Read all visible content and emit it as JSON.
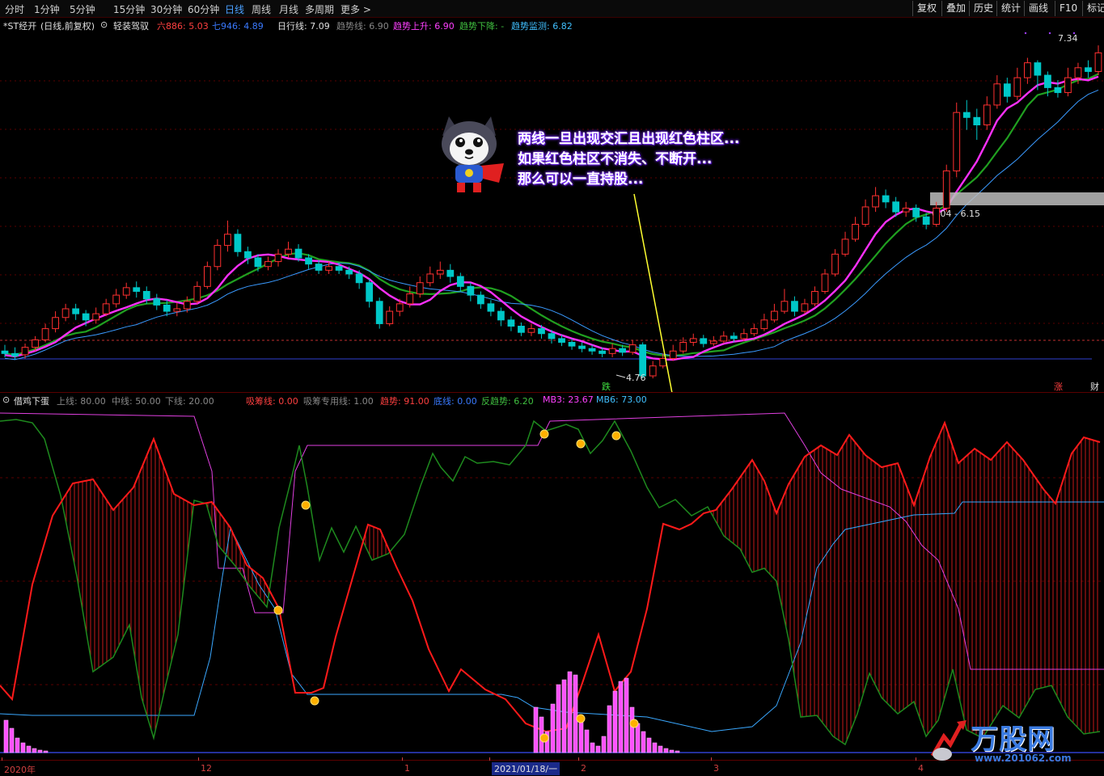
{
  "toolbar": {
    "periods": [
      "分时",
      "1分钟",
      "5分钟",
      "15分钟",
      "30分钟",
      "60分钟",
      "日线",
      "周线",
      "月线",
      "多周期",
      "更多 >"
    ],
    "active_period": "日线",
    "right_buttons": [
      "复权",
      "叠加",
      "历史",
      "统计",
      "画线",
      "F10",
      "标记"
    ]
  },
  "main_panel": {
    "stock": "*ST经开",
    "mode": "(日线,前复权)",
    "indicator_name": "轻装驾驭",
    "legend": [
      {
        "label": "六886: 5.03",
        "color": "#ff4040"
      },
      {
        "label": "七946: 4.89",
        "color": "#3a7aff"
      },
      {
        "label": "日行线: 7.09",
        "color": "#e0e0e0"
      },
      {
        "label": "趋势线: 6.90",
        "color": "#888888"
      },
      {
        "label": "趋势上升: 6.90",
        "color": "#ff40ff"
      },
      {
        "label": "趋势下降: -",
        "color": "#40c040"
      },
      {
        "label": "趋势监测: 6.82",
        "color": "#40c0ff"
      }
    ],
    "price_high_label": "7.34",
    "price_low_label": "4.76",
    "range_box_label": "6.04 - 6.15",
    "tags": {
      "fall": "跌",
      "rise": "涨",
      "fin": "财"
    }
  },
  "annotation": {
    "lines": [
      "两线一旦出现交汇且出现红色柱区...",
      "如果红色柱区不消失、不断开...",
      "那么可以一直持股..."
    ]
  },
  "sub_panel": {
    "indicator_name": "借鸡下蛋",
    "legend": [
      {
        "label": "上线: 80.00",
        "color": "#888888"
      },
      {
        "label": "中线: 50.00",
        "color": "#888888"
      },
      {
        "label": "下线: 20.00",
        "color": "#888888"
      },
      {
        "label": "吸筹线: 0.00",
        "color": "#ff4040"
      },
      {
        "label": "吸筹专用线: 1.00",
        "color": "#888888"
      },
      {
        "label": "趋势: 91.00",
        "color": "#ff4040"
      },
      {
        "label": "底线: 0.00",
        "color": "#3a7aff"
      },
      {
        "label": "反趋势: 6.20",
        "color": "#40c040"
      },
      {
        "label": "MB3: 23.67",
        "color": "#ff40ff"
      },
      {
        "label": "MB6: 73.00",
        "color": "#40c0ff"
      }
    ]
  },
  "date_axis": {
    "labels": [
      "2020年",
      "12",
      "1",
      "2021/01/18/一",
      "2",
      "3",
      "4"
    ],
    "selected": "2021/01/18/一"
  },
  "watermark": {
    "brand": "万股网",
    "url": "www.201062.com"
  },
  "colors": {
    "up": "#ff3030",
    "down": "#00c8c8",
    "ma_magenta": "#ff30ff",
    "ma_blue": "#3a9aff",
    "ma_green": "#20a020",
    "trend_red": "#ff1a1a",
    "counter_green": "#1e8a1e",
    "mb3": "#e040e0",
    "mb6": "#3aa8ff"
  },
  "chart_data": {
    "type": "candlestick",
    "price_range": [
      4.76,
      7.34
    ],
    "candles": [
      [
        4.9,
        4.88,
        4.95,
        4.85
      ],
      [
        4.88,
        4.86,
        4.93,
        4.83
      ],
      [
        4.87,
        4.93,
        4.96,
        4.84
      ],
      [
        4.93,
        4.99,
        5.02,
        4.9
      ],
      [
        4.99,
        5.08,
        5.12,
        4.97
      ],
      [
        5.08,
        5.17,
        5.22,
        5.05
      ],
      [
        5.17,
        5.24,
        5.28,
        5.14
      ],
      [
        5.24,
        5.2,
        5.28,
        5.15
      ],
      [
        5.2,
        5.15,
        5.23,
        5.1
      ],
      [
        5.15,
        5.2,
        5.25,
        5.12
      ],
      [
        5.2,
        5.28,
        5.32,
        5.18
      ],
      [
        5.28,
        5.35,
        5.4,
        5.25
      ],
      [
        5.35,
        5.41,
        5.45,
        5.32
      ],
      [
        5.41,
        5.38,
        5.46,
        5.33
      ],
      [
        5.38,
        5.32,
        5.42,
        5.28
      ],
      [
        5.32,
        5.27,
        5.36,
        5.23
      ],
      [
        5.27,
        5.22,
        5.31,
        5.18
      ],
      [
        5.22,
        5.24,
        5.29,
        5.18
      ],
      [
        5.24,
        5.3,
        5.34,
        5.21
      ],
      [
        5.3,
        5.42,
        5.46,
        5.28
      ],
      [
        5.42,
        5.58,
        5.62,
        5.4
      ],
      [
        5.58,
        5.75,
        5.8,
        5.55
      ],
      [
        5.75,
        5.84,
        5.95,
        5.7
      ],
      [
        5.84,
        5.7,
        5.88,
        5.66
      ],
      [
        5.7,
        5.65,
        5.74,
        5.6
      ],
      [
        5.65,
        5.58,
        5.68,
        5.54
      ],
      [
        5.58,
        5.62,
        5.66,
        5.55
      ],
      [
        5.62,
        5.68,
        5.72,
        5.58
      ],
      [
        5.68,
        5.72,
        5.78,
        5.65
      ],
      [
        5.72,
        5.65,
        5.76,
        5.62
      ],
      [
        5.65,
        5.6,
        5.68,
        5.56
      ],
      [
        5.6,
        5.55,
        5.63,
        5.52
      ],
      [
        5.55,
        5.58,
        5.62,
        5.52
      ],
      [
        5.58,
        5.55,
        5.61,
        5.52
      ],
      [
        5.55,
        5.52,
        5.58,
        5.48
      ],
      [
        5.52,
        5.45,
        5.55,
        5.4
      ],
      [
        5.45,
        5.3,
        5.48,
        5.25
      ],
      [
        5.3,
        5.12,
        5.33,
        5.08
      ],
      [
        5.12,
        5.22,
        5.26,
        5.1
      ],
      [
        5.22,
        5.28,
        5.32,
        5.18
      ],
      [
        5.28,
        5.36,
        5.42,
        5.25
      ],
      [
        5.36,
        5.45,
        5.5,
        5.33
      ],
      [
        5.45,
        5.52,
        5.58,
        5.42
      ],
      [
        5.52,
        5.55,
        5.62,
        5.48
      ],
      [
        5.55,
        5.5,
        5.6,
        5.45
      ],
      [
        5.5,
        5.42,
        5.53,
        5.38
      ],
      [
        5.42,
        5.35,
        5.45,
        5.3
      ],
      [
        5.35,
        5.28,
        5.38,
        5.24
      ],
      [
        5.28,
        5.22,
        5.31,
        5.18
      ],
      [
        5.22,
        5.15,
        5.25,
        5.1
      ],
      [
        5.15,
        5.1,
        5.18,
        5.06
      ],
      [
        5.1,
        5.05,
        5.13,
        5.02
      ],
      [
        5.05,
        5.08,
        5.12,
        5.02
      ],
      [
        5.08,
        5.04,
        5.11,
        5.0
      ],
      [
        5.04,
        5.0,
        5.07,
        4.96
      ],
      [
        5.0,
        4.97,
        5.03,
        4.94
      ],
      [
        4.97,
        4.94,
        5.0,
        4.91
      ],
      [
        4.94,
        4.92,
        4.97,
        4.89
      ],
      [
        4.92,
        4.9,
        4.95,
        4.87
      ],
      [
        4.9,
        4.88,
        4.93,
        4.85
      ],
      [
        4.88,
        4.92,
        4.96,
        4.85
      ],
      [
        4.92,
        4.89,
        4.95,
        4.86
      ],
      [
        4.89,
        4.95,
        4.99,
        4.87
      ],
      [
        4.95,
        4.7,
        4.97,
        4.68
      ],
      [
        4.7,
        4.78,
        4.82,
        4.68
      ],
      [
        4.78,
        4.84,
        4.88,
        4.76
      ],
      [
        4.84,
        4.9,
        4.95,
        4.82
      ],
      [
        4.9,
        4.97,
        5.01,
        4.88
      ],
      [
        4.97,
        5.0,
        5.04,
        4.94
      ],
      [
        5.0,
        4.96,
        5.03,
        4.93
      ],
      [
        4.96,
        4.98,
        5.02,
        4.94
      ],
      [
        4.98,
        5.02,
        5.06,
        4.96
      ],
      [
        5.02,
        5.0,
        5.05,
        4.97
      ],
      [
        5.0,
        5.04,
        5.08,
        4.98
      ],
      [
        5.04,
        5.08,
        5.12,
        5.02
      ],
      [
        5.08,
        5.15,
        5.2,
        5.06
      ],
      [
        5.15,
        5.22,
        5.28,
        5.13
      ],
      [
        5.22,
        5.3,
        5.4,
        5.2
      ],
      [
        5.3,
        5.22,
        5.34,
        5.18
      ],
      [
        5.22,
        5.28,
        5.32,
        5.2
      ],
      [
        5.28,
        5.38,
        5.42,
        5.26
      ],
      [
        5.38,
        5.52,
        5.56,
        5.36
      ],
      [
        5.52,
        5.68,
        5.72,
        5.5
      ],
      [
        5.68,
        5.8,
        5.86,
        5.66
      ],
      [
        5.8,
        5.92,
        5.98,
        5.78
      ],
      [
        5.92,
        6.06,
        6.12,
        5.9
      ],
      [
        6.06,
        6.15,
        6.22,
        6.02
      ],
      [
        6.15,
        6.1,
        6.2,
        6.05
      ],
      [
        6.1,
        6.02,
        6.14,
        5.98
      ],
      [
        6.02,
        6.05,
        6.1,
        5.98
      ],
      [
        6.05,
        5.98,
        6.08,
        5.94
      ],
      [
        5.98,
        5.92,
        6.01,
        5.88
      ],
      [
        5.92,
        6.05,
        6.1,
        5.9
      ],
      [
        6.05,
        6.35,
        6.4,
        6.02
      ],
      [
        6.35,
        6.82,
        6.9,
        6.3
      ],
      [
        6.82,
        6.78,
        6.92,
        6.68
      ],
      [
        6.78,
        6.72,
        6.85,
        6.6
      ],
      [
        6.72,
        6.88,
        6.95,
        6.68
      ],
      [
        6.88,
        7.05,
        7.12,
        6.85
      ],
      [
        7.05,
        6.95,
        7.1,
        6.9
      ],
      [
        6.95,
        7.1,
        7.18,
        6.92
      ],
      [
        7.1,
        7.22,
        7.26,
        7.05
      ],
      [
        7.22,
        7.12,
        7.24,
        7.0
      ],
      [
        7.12,
        7.02,
        7.15,
        6.95
      ],
      [
        7.02,
        6.98,
        7.08,
        6.94
      ],
      [
        6.98,
        7.1,
        7.18,
        6.95
      ],
      [
        7.1,
        7.18,
        7.22,
        7.05
      ],
      [
        7.18,
        7.15,
        7.24,
        7.1
      ],
      [
        7.15,
        7.3,
        7.36,
        7.12
      ]
    ],
    "sub_range": [
      0,
      100
    ]
  }
}
